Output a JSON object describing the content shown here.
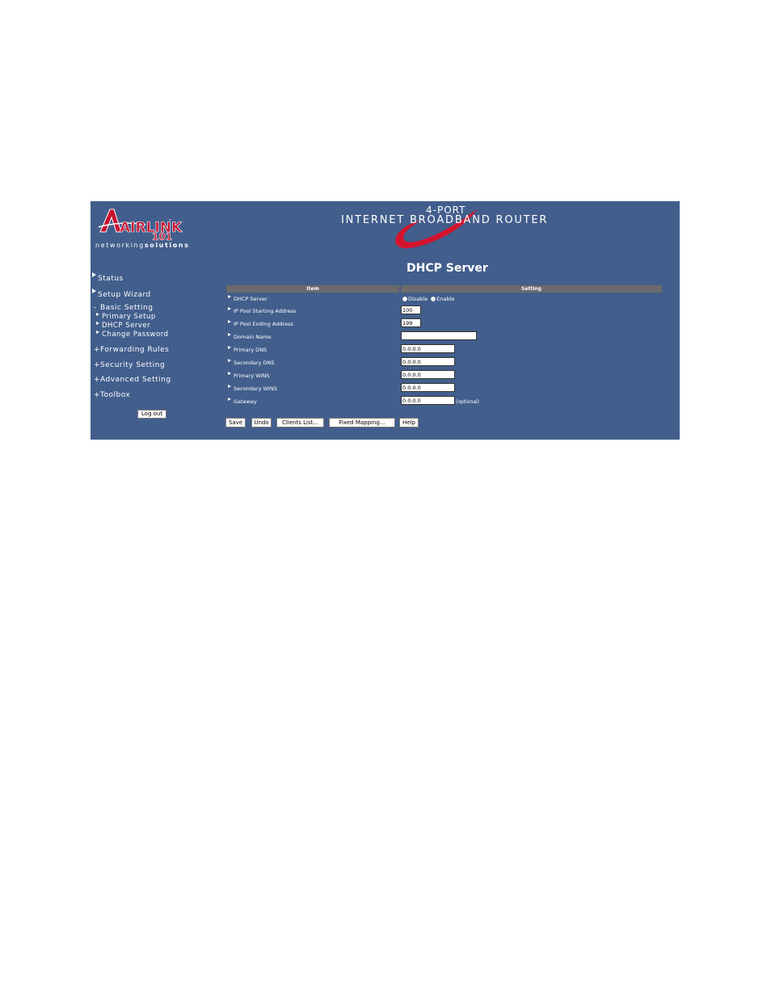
{
  "brand": {
    "logo_text": "AIRLINK",
    "logo_tm": "™",
    "logo_number": "101",
    "tagline_prefix": "networking",
    "tagline_suffix": "solutions",
    "banner_line1": "4-PORT",
    "banner_line2": "INTERNET BROADBAND ROUTER"
  },
  "sidebar": {
    "status": "Status",
    "setup_wizard": "Setup Wizard",
    "basic_setting": "Basic Setting",
    "basic_prefix": "-",
    "primary_setup": "Primary Setup",
    "dhcp_server": "DHCP Server",
    "change_password": "Change Password",
    "forwarding_rules": "Forwarding Rules",
    "security_setting": "Security Setting",
    "advanced_setting": "Advanced Setting",
    "toolbox": "Toolbox",
    "plus": "+",
    "logout": "Log out"
  },
  "main": {
    "title": "DHCP Server",
    "col_item": "Item",
    "col_setting": "Setting",
    "rows": {
      "dhcp_server": "DHCP Server",
      "ip_pool_start": "IP Pool Starting Address",
      "ip_pool_end": "IP Pool Ending Address",
      "domain_name": "Domain Name",
      "primary_dns": "Primary DNS",
      "secondary_dns": "Secondary DNS",
      "primary_wins": "Primary WINS",
      "secondary_wins": "Secondary WINS",
      "gateway": "Gateway"
    },
    "radio_disable": "Disable",
    "radio_enable": "Enable",
    "radio_selected": "Enable",
    "values": {
      "ip_pool_start": "100",
      "ip_pool_end": "199",
      "domain_name": "",
      "primary_dns": "0.0.0.0",
      "secondary_dns": "0.0.0.0",
      "primary_wins": "0.0.0.0",
      "secondary_wins": "0.0.0.0",
      "gateway": "0.0.0.0"
    },
    "optional_note": "(optional)",
    "buttons": {
      "save": "Save",
      "undo": "Undo",
      "clients_list": "Clients List...",
      "fixed_mapping": "Fixed Mapping...",
      "help": "Help"
    }
  },
  "colors": {
    "panel_background": "#425e8c",
    "header_bar": "#6b6b6b",
    "logo_red": "#c8102e",
    "swoosh_red": "#d4142e"
  },
  "icons": [
    "airlink-logo-icon",
    "banner-swoosh-icon",
    "nav-arrow-icon",
    "radio-icon"
  ]
}
